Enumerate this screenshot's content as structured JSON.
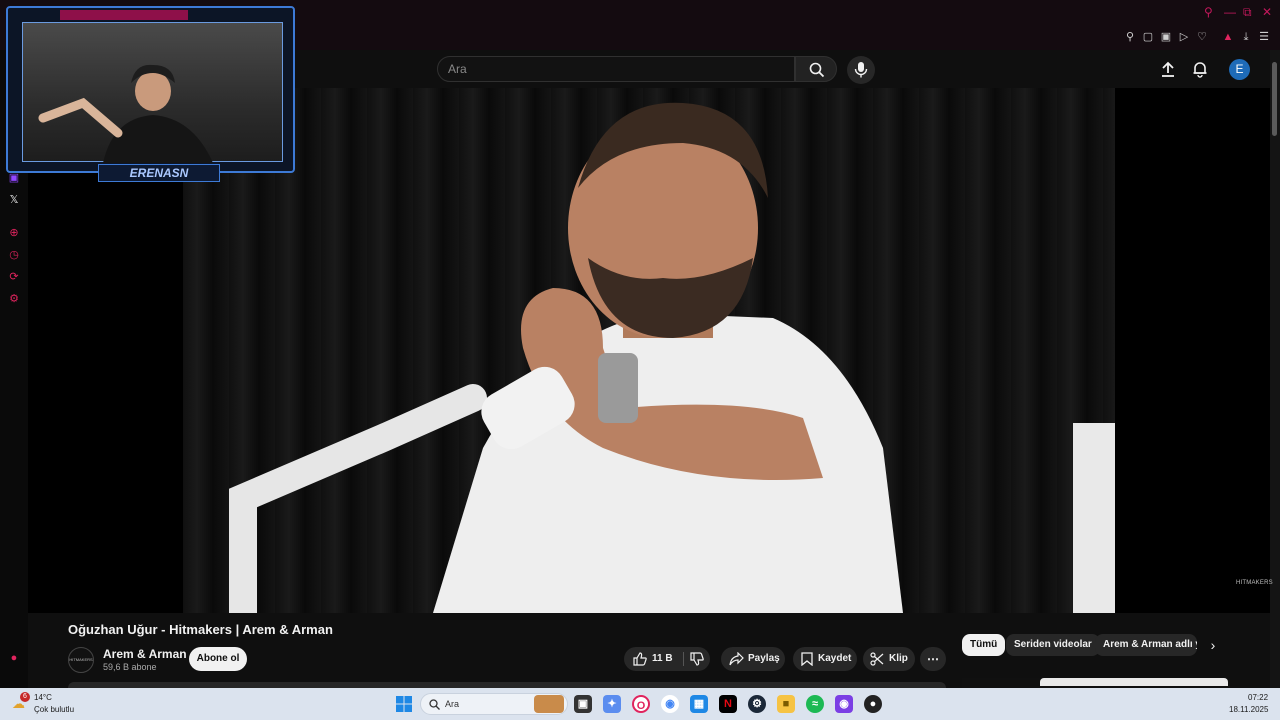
{
  "search": {
    "placeholder": "Ara"
  },
  "header": {
    "avatar_letter": "E"
  },
  "webcam": {
    "streamer_name": "ERENASN"
  },
  "video": {
    "title": "Oğuzhan Uğur - Hitmakers | Arem & Arman",
    "watermark": "HITMAKERS"
  },
  "channel": {
    "name": "Arem & Arman",
    "subscribers": "59,6 B abone",
    "logo_text": "HITMAKERS",
    "subscribe_label": "Abone ol"
  },
  "actions": {
    "like_count": "11 B",
    "share_label": "Paylaş",
    "save_label": "Kaydet",
    "clip_label": "Klip"
  },
  "chips": [
    "Tümü",
    "Seriden videolar",
    "Arem & Arman adlı yü"
  ],
  "taskbar": {
    "temperature": "14°C",
    "weather": "Çok bulutlu",
    "weather_badge": "6",
    "search_placeholder": "Ara",
    "time": "07:22",
    "date": "18.11.2025"
  },
  "colors": {
    "accent_pink": "#e0245e",
    "youtube_bg": "#0f0f0f",
    "avatar_blue": "#1e6bb8",
    "webcam_frame": "#3d7ad6"
  }
}
